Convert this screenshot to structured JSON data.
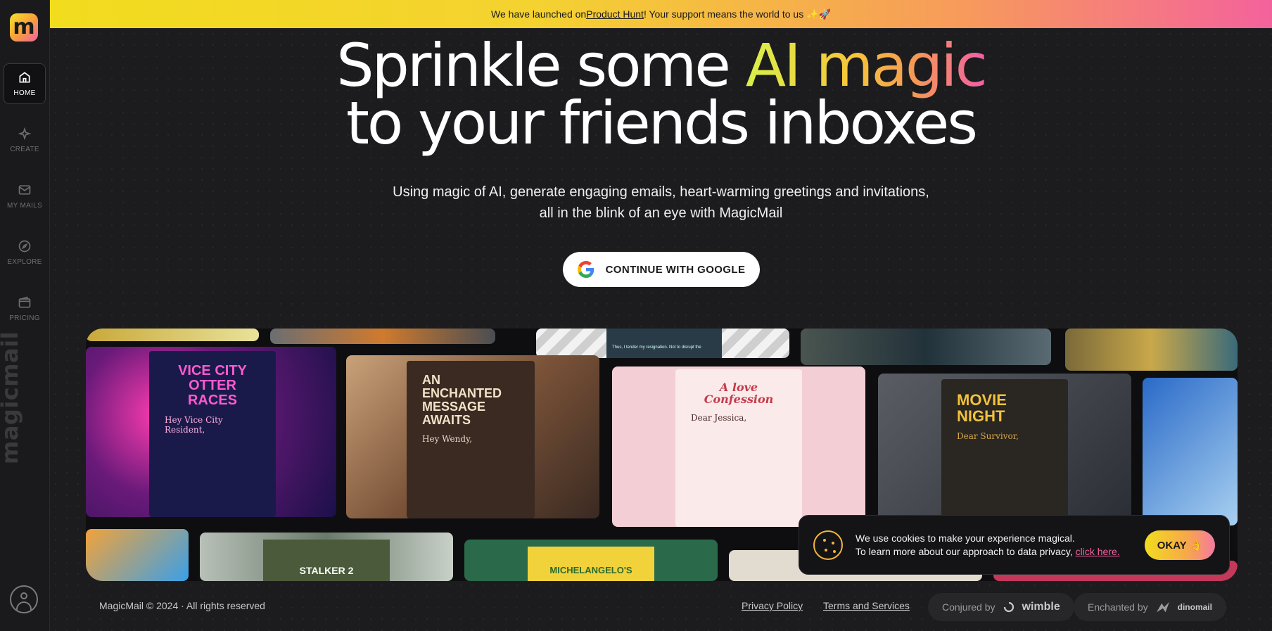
{
  "sidebar": {
    "logo": "m",
    "items": [
      {
        "label": "HOME",
        "icon": "home-icon"
      },
      {
        "label": "CREATE",
        "icon": "sparkle-icon"
      },
      {
        "label": "MY MAILS",
        "icon": "mail-icon"
      },
      {
        "label": "EXPLORE",
        "icon": "compass-icon"
      },
      {
        "label": "PRICING",
        "icon": "wallet-icon"
      }
    ],
    "vertical_brand": "magicmail"
  },
  "banner": {
    "prefix": "We have launched on ",
    "link": "Product Hunt",
    "suffix": "! Your support means the world to us ✨🚀"
  },
  "hero": {
    "title_part1": "Sprinkle some ",
    "title_highlight": "AI magic",
    "title_line2": "to your friends inboxes",
    "subtitle_line1": "Using magic of AI, generate engaging emails, heart-warming greetings and invitations,",
    "subtitle_line2": "all in the blink of an eye with MagicMail",
    "cta": "CONTINUE WITH GOOGLE"
  },
  "gallery": {
    "cards": [
      {
        "title": "VICE CITY OTTER RACES",
        "greeting": "Hey Vice City Resident,"
      },
      {
        "title": "AN ENCHANTED MESSAGE AWAITS",
        "greeting": "Hey Wendy,"
      },
      {
        "title": "A love Confession",
        "greeting": "Dear Jessica,"
      },
      {
        "title": "MOVIE NIGHT",
        "greeting": "Dear Survivor,"
      },
      {
        "title": "STALKER 2",
        "greeting": ""
      },
      {
        "title": "MICHELANGELO'S",
        "greeting": ""
      }
    ],
    "snippet_top": "Thus, I tender my resignation. Not to disrupt the"
  },
  "cookie": {
    "line1": "We use cookies to make your experience magical.",
    "line2": "To learn more about our approach to data privacy, ",
    "link": "click here.",
    "button": "OKAY 👌"
  },
  "footer": {
    "copyright": "MagicMail © 2024  ·  All rights reserved",
    "privacy": "Privacy Policy",
    "terms": "Terms and Services",
    "conjured_label": "Conjured by",
    "conjured_brand": "wimble",
    "enchanted_label": "Enchanted by",
    "enchanted_brand": "dinomail"
  },
  "colors": {
    "accent_yellow": "#f2dc1e",
    "accent_pink": "#f061a0",
    "background": "#1c1c1e"
  }
}
